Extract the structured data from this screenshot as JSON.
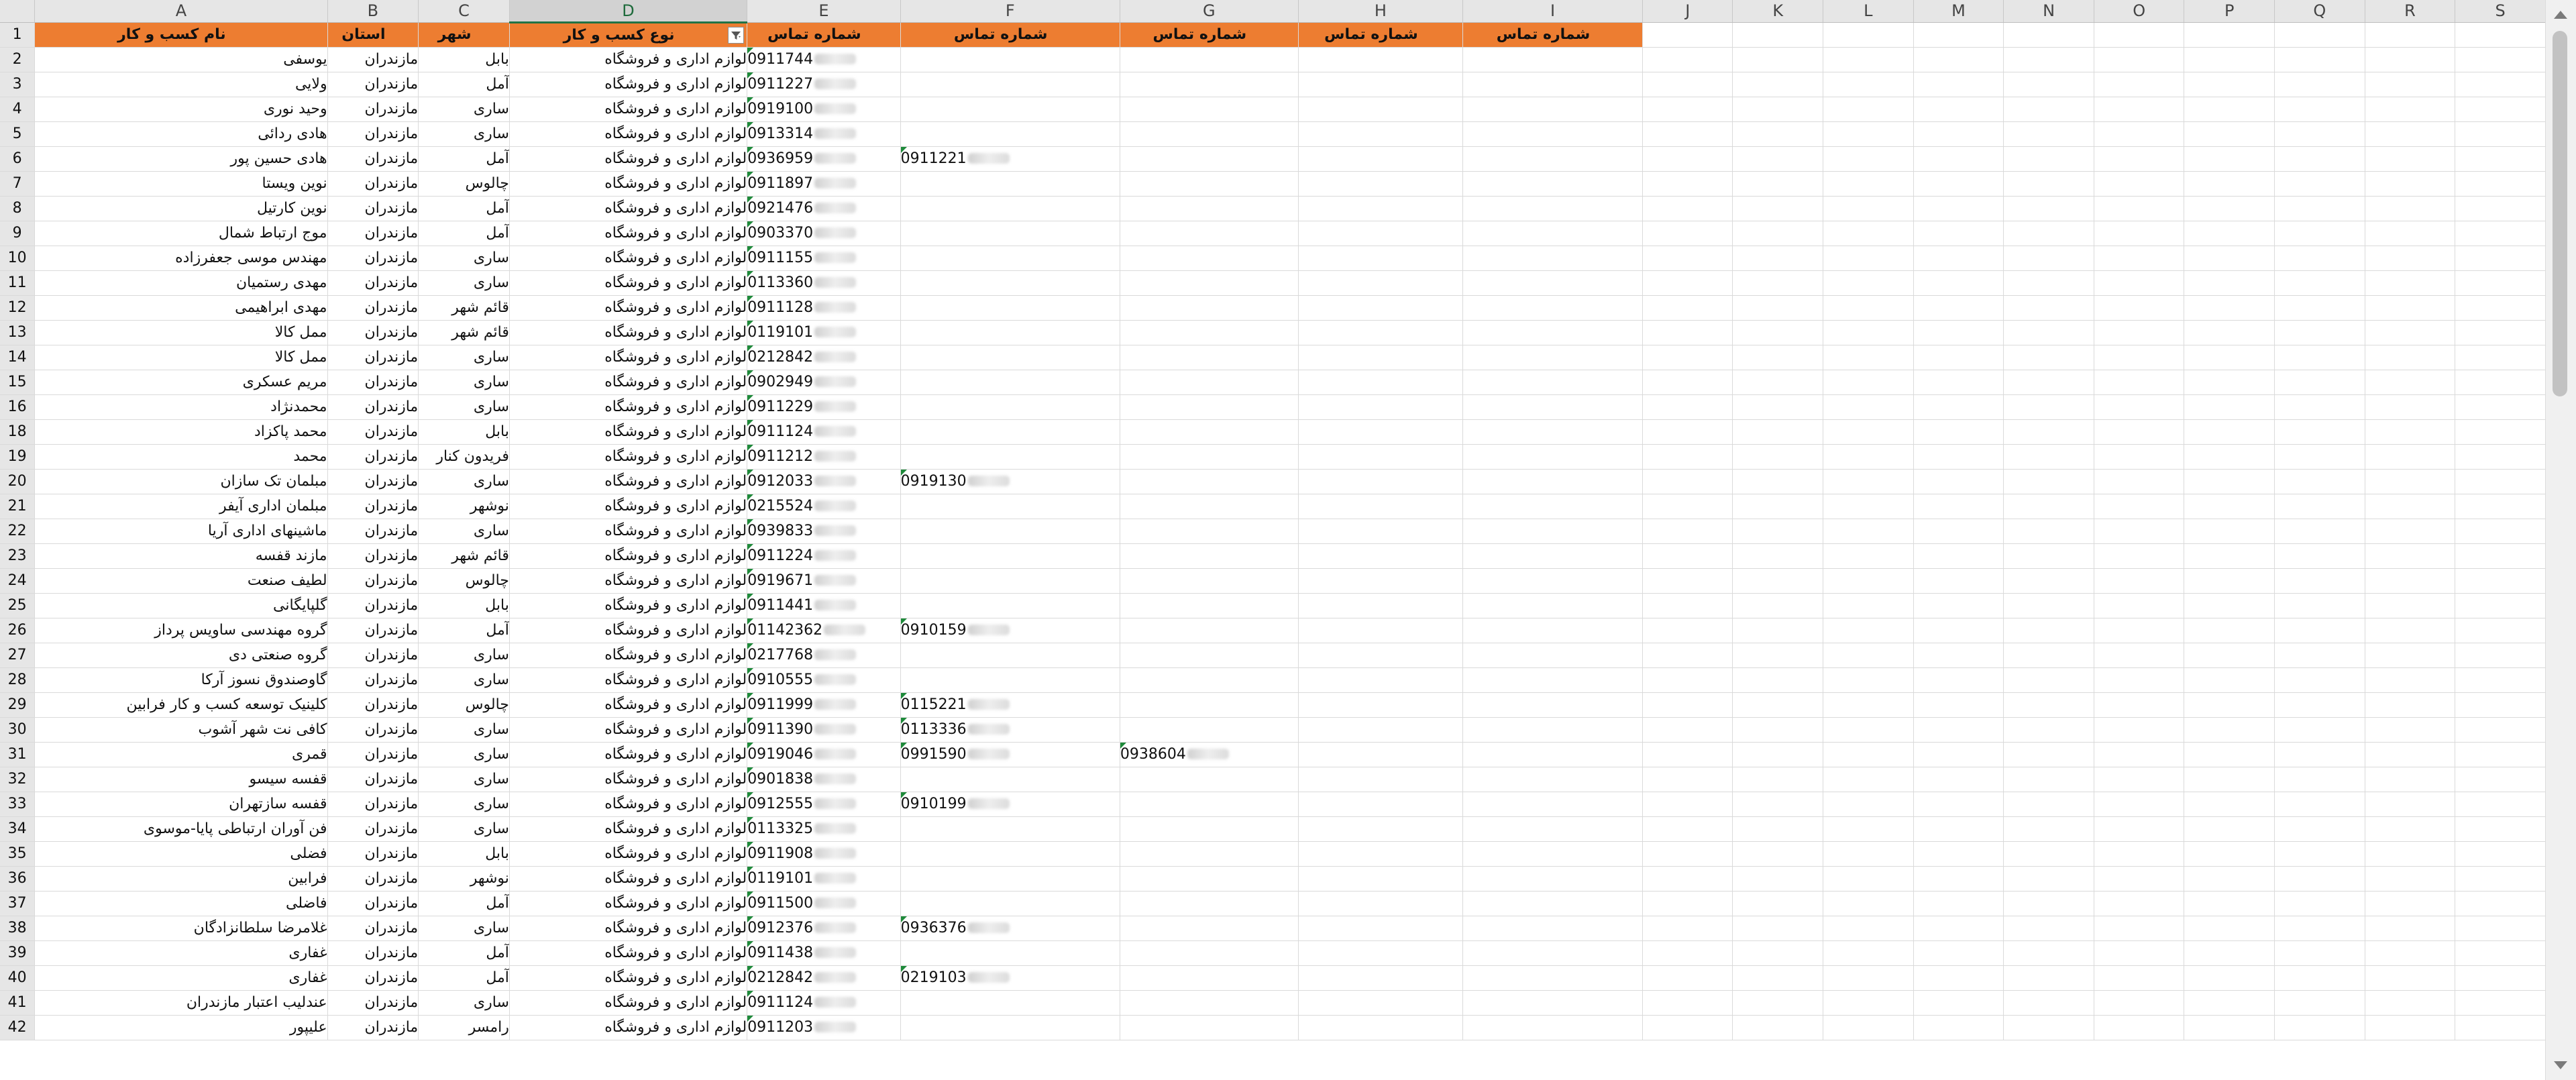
{
  "columns": [
    "A",
    "B",
    "C",
    "D",
    "E",
    "F",
    "G",
    "H",
    "I",
    "J",
    "K",
    "L",
    "M",
    "N",
    "O",
    "P",
    "Q",
    "R",
    "S"
  ],
  "selected_column": "D",
  "header_row": {
    "row_number": "1",
    "cells": [
      "نام کسب و کار",
      "استان",
      "شهر",
      "نوع کسب و کار",
      "شماره تماس",
      "شماره تماس",
      "شماره تماس",
      "شماره تماس",
      "شماره تماس"
    ]
  },
  "rows": [
    {
      "n": "2",
      "name": "یوسفی",
      "province": "مازندران",
      "city": "بابل",
      "type": "لوازم اداری و فروشگاه",
      "p1": "0911744",
      "p2": "",
      "p3": ""
    },
    {
      "n": "3",
      "name": "ولایی",
      "province": "مازندران",
      "city": "آمل",
      "type": "لوازم اداری و فروشگاه",
      "p1": "0911227",
      "p2": "",
      "p3": ""
    },
    {
      "n": "4",
      "name": "وحید نوری",
      "province": "مازندران",
      "city": "ساری",
      "type": "لوازم اداری و فروشگاه",
      "p1": "0919100",
      "p2": "",
      "p3": ""
    },
    {
      "n": "5",
      "name": "هادی ردائی",
      "province": "مازندران",
      "city": "ساری",
      "type": "لوازم اداری و فروشگاه",
      "p1": "0913314",
      "p2": "",
      "p3": ""
    },
    {
      "n": "6",
      "name": "هادی حسین پور",
      "province": "مازندران",
      "city": "آمل",
      "type": "لوازم اداری و فروشگاه",
      "p1": "0936959",
      "p2": "0911221",
      "p3": ""
    },
    {
      "n": "7",
      "name": "نوین ویستا",
      "province": "مازندران",
      "city": "چالوس",
      "type": "لوازم اداری و فروشگاه",
      "p1": "0911897",
      "p2": "",
      "p3": ""
    },
    {
      "n": "8",
      "name": "نوین کارتیل",
      "province": "مازندران",
      "city": "آمل",
      "type": "لوازم اداری و فروشگاه",
      "p1": "0921476",
      "p2": "",
      "p3": ""
    },
    {
      "n": "9",
      "name": "موج ارتباط شمال",
      "province": "مازندران",
      "city": "آمل",
      "type": "لوازم اداری و فروشگاه",
      "p1": "0903370",
      "p2": "",
      "p3": ""
    },
    {
      "n": "10",
      "name": "مهندس موسی جعفرزاده",
      "province": "مازندران",
      "city": "ساری",
      "type": "لوازم اداری و فروشگاه",
      "p1": "0911155",
      "p2": "",
      "p3": ""
    },
    {
      "n": "11",
      "name": "مهدی رستمیان",
      "province": "مازندران",
      "city": "ساری",
      "type": "لوازم اداری و فروشگاه",
      "p1": "0113360",
      "p2": "",
      "p3": ""
    },
    {
      "n": "12",
      "name": "مهدی ابراهیمی",
      "province": "مازندران",
      "city": "قائم شهر",
      "type": "لوازم اداری و فروشگاه",
      "p1": "0911128",
      "p2": "",
      "p3": ""
    },
    {
      "n": "13",
      "name": "ممل کالا",
      "province": "مازندران",
      "city": "قائم شهر",
      "type": "لوازم اداری و فروشگاه",
      "p1": "0119101",
      "p2": "",
      "p3": ""
    },
    {
      "n": "14",
      "name": "ممل کالا",
      "province": "مازندران",
      "city": "ساری",
      "type": "لوازم اداری و فروشگاه",
      "p1": "0212842",
      "p2": "",
      "p3": ""
    },
    {
      "n": "15",
      "name": "مریم عسکری",
      "province": "مازندران",
      "city": "ساری",
      "type": "لوازم اداری و فروشگاه",
      "p1": "0902949",
      "p2": "",
      "p3": ""
    },
    {
      "n": "16",
      "name": "محمدنژاد",
      "province": "مازندران",
      "city": "ساری",
      "type": "لوازم اداری و فروشگاه",
      "p1": "0911229",
      "p2": "",
      "p3": ""
    },
    {
      "n": "18",
      "name": "محمد پاکزاد",
      "province": "مازندران",
      "city": "بابل",
      "type": "لوازم اداری و فروشگاه",
      "p1": "0911124",
      "p2": "",
      "p3": ""
    },
    {
      "n": "19",
      "name": "محمد",
      "province": "مازندران",
      "city": "فریدون کنار",
      "type": "لوازم اداری و فروشگاه",
      "p1": "0911212",
      "p2": "",
      "p3": ""
    },
    {
      "n": "20",
      "name": "مبلمان تک سازان",
      "province": "مازندران",
      "city": "ساری",
      "type": "لوازم اداری و فروشگاه",
      "p1": "0912033",
      "p2": "0919130",
      "p3": ""
    },
    {
      "n": "21",
      "name": "مبلمان اداری آیفر",
      "province": "مازندران",
      "city": "نوشهر",
      "type": "لوازم اداری و فروشگاه",
      "p1": "0215524",
      "p2": "",
      "p3": ""
    },
    {
      "n": "22",
      "name": "ماشینهای اداری آریا",
      "province": "مازندران",
      "city": "ساری",
      "type": "لوازم اداری و فروشگاه",
      "p1": "0939833",
      "p2": "",
      "p3": ""
    },
    {
      "n": "23",
      "name": "مازند قفسه",
      "province": "مازندران",
      "city": "قائم شهر",
      "type": "لوازم اداری و فروشگاه",
      "p1": "0911224",
      "p2": "",
      "p3": ""
    },
    {
      "n": "24",
      "name": "لطیف صنعت",
      "province": "مازندران",
      "city": "چالوس",
      "type": "لوازم اداری و فروشگاه",
      "p1": "0919671",
      "p2": "",
      "p3": ""
    },
    {
      "n": "25",
      "name": "گلپایگانی",
      "province": "مازندران",
      "city": "بابل",
      "type": "لوازم اداری و فروشگاه",
      "p1": "0911441",
      "p2": "",
      "p3": ""
    },
    {
      "n": "26",
      "name": "گروه مهندسی ساویس پرداز",
      "province": "مازندران",
      "city": "آمل",
      "type": "لوازم اداری و فروشگاه",
      "p1": "01142362",
      "p2": "0910159",
      "p3": ""
    },
    {
      "n": "27",
      "name": "گروه صنعتی دی",
      "province": "مازندران",
      "city": "ساری",
      "type": "لوازم اداری و فروشگاه",
      "p1": "0217768",
      "p2": "",
      "p3": ""
    },
    {
      "n": "28",
      "name": "گاوصندوق نسوز آرکا",
      "province": "مازندران",
      "city": "ساری",
      "type": "لوازم اداری و فروشگاه",
      "p1": "0910555",
      "p2": "",
      "p3": ""
    },
    {
      "n": "29",
      "name": "کلینیک توسعه کسب و کار فرابین",
      "province": "مازندران",
      "city": "چالوس",
      "type": "لوازم اداری و فروشگاه",
      "p1": "0911999",
      "p2": "0115221",
      "p3": ""
    },
    {
      "n": "30",
      "name": "کافی نت شهر آشوب",
      "province": "مازندران",
      "city": "ساری",
      "type": "لوازم اداری و فروشگاه",
      "p1": "0911390",
      "p2": "0113336",
      "p3": ""
    },
    {
      "n": "31",
      "name": "قمری",
      "province": "مازندران",
      "city": "ساری",
      "type": "لوازم اداری و فروشگاه",
      "p1": "0919046",
      "p2": "0991590",
      "p3": "0938604"
    },
    {
      "n": "32",
      "name": "قفسه سیسو",
      "province": "مازندران",
      "city": "ساری",
      "type": "لوازم اداری و فروشگاه",
      "p1": "0901838",
      "p2": "",
      "p3": ""
    },
    {
      "n": "33",
      "name": "قفسه سازتهران",
      "province": "مازندران",
      "city": "ساری",
      "type": "لوازم اداری و فروشگاه",
      "p1": "0912555",
      "p2": "0910199",
      "p3": ""
    },
    {
      "n": "34",
      "name": "فن آوران ارتباطی پایا-موسوی",
      "province": "مازندران",
      "city": "ساری",
      "type": "لوازم اداری و فروشگاه",
      "p1": "0113325",
      "p2": "",
      "p3": ""
    },
    {
      "n": "35",
      "name": "فضلی",
      "province": "مازندران",
      "city": "بابل",
      "type": "لوازم اداری و فروشگاه",
      "p1": "0911908",
      "p2": "",
      "p3": ""
    },
    {
      "n": "36",
      "name": "فرابین",
      "province": "مازندران",
      "city": "نوشهر",
      "type": "لوازم اداری و فروشگاه",
      "p1": "0119101",
      "p2": "",
      "p3": ""
    },
    {
      "n": "37",
      "name": "فاضلی",
      "province": "مازندران",
      "city": "آمل",
      "type": "لوازم اداری و فروشگاه",
      "p1": "0911500",
      "p2": "",
      "p3": ""
    },
    {
      "n": "38",
      "name": "غلامرضا سلطانزادگان",
      "province": "مازندران",
      "city": "ساری",
      "type": "لوازم اداری و فروشگاه",
      "p1": "0912376",
      "p2": "0936376",
      "p3": ""
    },
    {
      "n": "39",
      "name": "غفاری",
      "province": "مازندران",
      "city": "آمل",
      "type": "لوازم اداری و فروشگاه",
      "p1": "0911438",
      "p2": "",
      "p3": ""
    },
    {
      "n": "40",
      "name": "غفاری",
      "province": "مازندران",
      "city": "آمل",
      "type": "لوازم اداری و فروشگاه",
      "p1": "0212842",
      "p2": "0219103",
      "p3": ""
    },
    {
      "n": "41",
      "name": "عندلیب اعتبار مازندران",
      "province": "مازندران",
      "city": "ساری",
      "type": "لوازم اداری و فروشگاه",
      "p1": "0911124",
      "p2": "",
      "p3": ""
    },
    {
      "n": "42",
      "name": "علیپور",
      "province": "مازندران",
      "city": "رامسر",
      "type": "لوازم اداری و فروشگاه",
      "p1": "0911203",
      "p2": "",
      "p3": ""
    }
  ],
  "colors": {
    "header_fill": "#ed7d31",
    "header_text": "#ffffff",
    "selected_col": "#217346"
  }
}
